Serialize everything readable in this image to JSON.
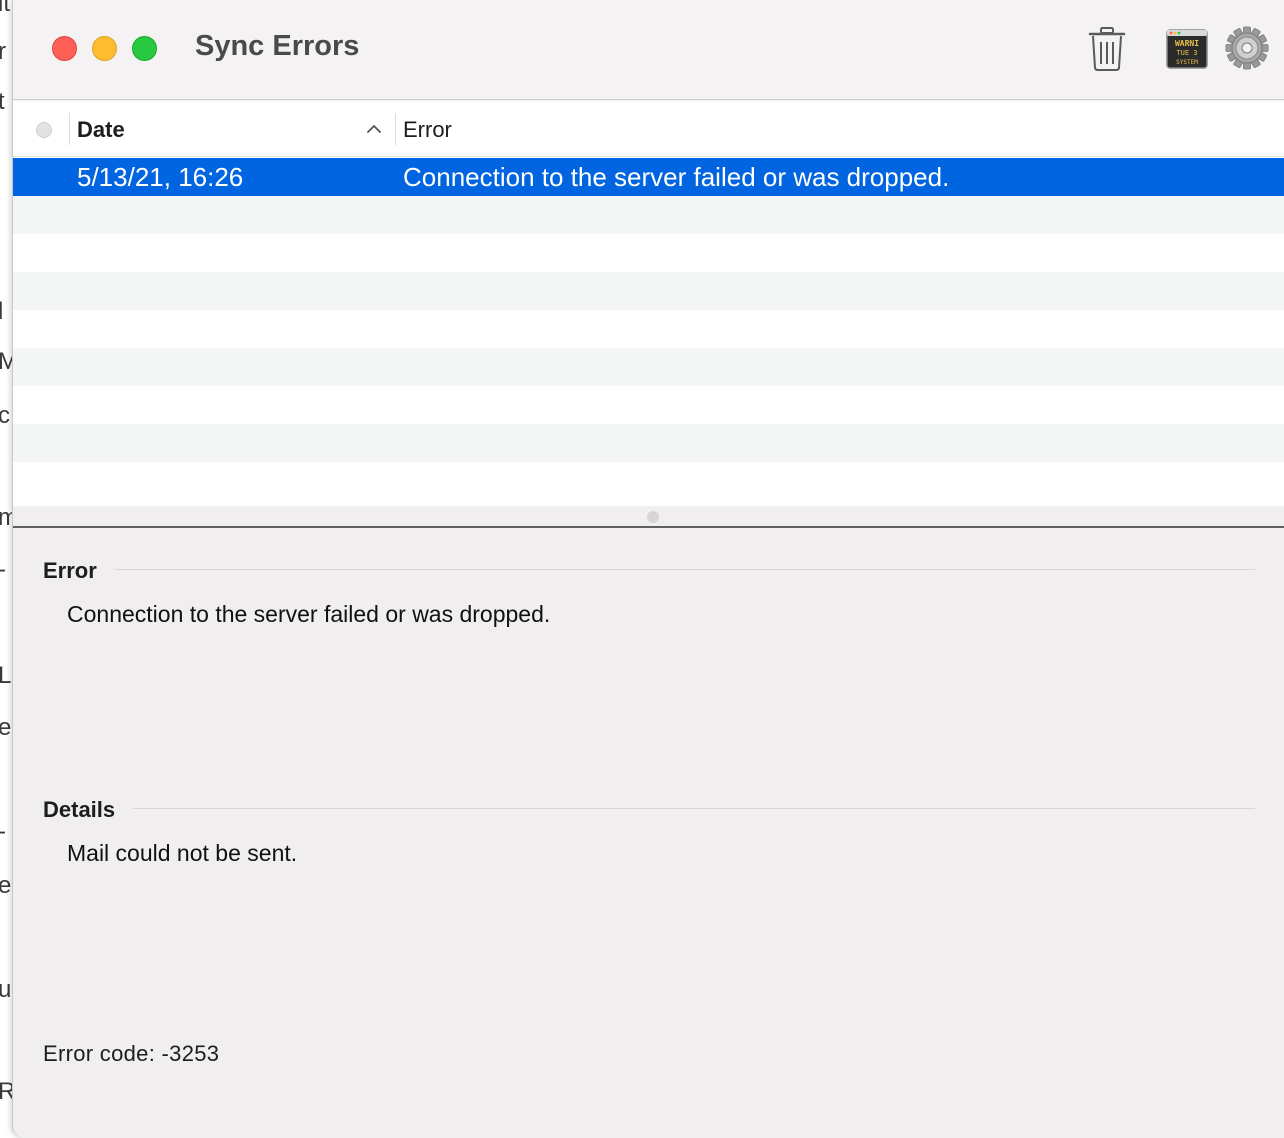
{
  "window": {
    "title": "Sync Errors"
  },
  "toolbar": {
    "trash_icon": "trash-icon",
    "console_icon": "console-app-icon",
    "console_label_lines": [
      "WARNI",
      "TUE 3",
      "SYSTEM"
    ],
    "settings_icon": "gear-icon"
  },
  "table": {
    "columns": {
      "status": "",
      "date": "Date",
      "error": "Error"
    },
    "sort": {
      "column": "Date",
      "direction": "ascending"
    },
    "rows": [
      {
        "date": "5/13/21, 16:26",
        "error": "Connection to the server failed or was dropped.",
        "selected": true
      }
    ]
  },
  "details": {
    "error_heading": "Error",
    "error_text": "Connection to the server failed or was dropped.",
    "details_heading": "Details",
    "details_text": "Mail could not be sent.",
    "error_code": "Error code: -3253"
  },
  "colors": {
    "selection": "#0164e1",
    "close": "#fe5f57",
    "minimize": "#febc2e",
    "zoom": "#28c840"
  }
}
